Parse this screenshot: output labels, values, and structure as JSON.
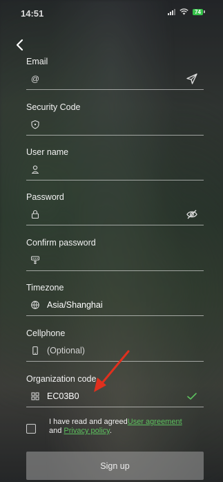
{
  "status_bar": {
    "time": "14:51",
    "battery": "74"
  },
  "form": {
    "email": {
      "label": "Email",
      "value": ""
    },
    "security_code": {
      "label": "Security Code",
      "value": ""
    },
    "user_name": {
      "label": "User name",
      "value": ""
    },
    "password": {
      "label": "Password",
      "value": ""
    },
    "confirm_password": {
      "label": "Confirm password",
      "value": ""
    },
    "timezone": {
      "label": "Timezone",
      "value": "Asia/Shanghai"
    },
    "cellphone": {
      "label": "Cellphone",
      "placeholder": "(Optional)"
    },
    "organization_code": {
      "label": "Organization code",
      "value": "EC03B0"
    }
  },
  "agreement": {
    "prefix": "I have read and agreed",
    "user_agreement": "User agreement",
    "and": "and",
    "privacy_policy": "Privacy policy",
    "suffix": "."
  },
  "signup_label": "Sign up",
  "colors": {
    "accent_green": "#5dc25f",
    "annotation_red": "#e0301e"
  },
  "icons": [
    "back-icon",
    "at-icon",
    "send-icon",
    "shield-icon",
    "person-icon",
    "lock-icon",
    "eye-off-icon",
    "keypad-icon",
    "globe-icon",
    "phone-icon",
    "org-grid-icon",
    "check-icon",
    "red-arrow-annotation"
  ]
}
